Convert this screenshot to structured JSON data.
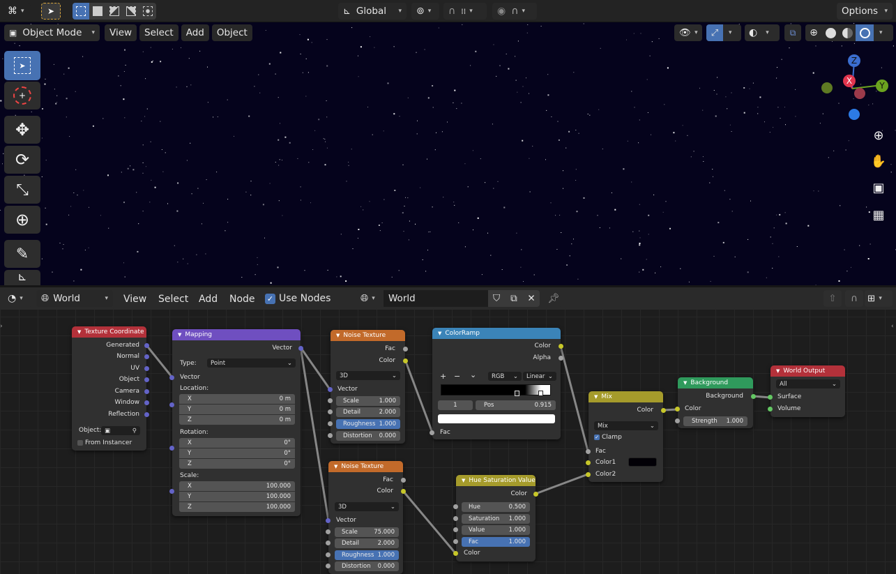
{
  "header": {
    "transform_orientation": "Global",
    "options_label": "Options"
  },
  "viewport": {
    "mode": "Object Mode",
    "menus": [
      "View",
      "Select",
      "Add",
      "Object"
    ],
    "gizmo": {
      "x": "X",
      "y": "Y",
      "z": "Z"
    },
    "bg_color": "#05031c"
  },
  "node_editor": {
    "type": "World",
    "menus": [
      "View",
      "Select",
      "Add",
      "Node"
    ],
    "use_nodes_label": "Use Nodes",
    "world_name": "World"
  },
  "nodes": {
    "texcoord": {
      "title": "Texture Coordinate",
      "outputs": [
        "Generated",
        "Normal",
        "UV",
        "Object",
        "Camera",
        "Window",
        "Reflection"
      ],
      "object_label": "Object:",
      "from_instancer": "From Instancer"
    },
    "mapping": {
      "title": "Mapping",
      "output": "Vector",
      "type_label": "Type:",
      "type_value": "Point",
      "vector": "Vector",
      "location": "Location:",
      "loc": [
        [
          "X",
          "0 m"
        ],
        [
          "Y",
          "0 m"
        ],
        [
          "Z",
          "0 m"
        ]
      ],
      "rotation": "Rotation:",
      "rot": [
        [
          "X",
          "0°"
        ],
        [
          "Y",
          "0°"
        ],
        [
          "Z",
          "0°"
        ]
      ],
      "scale": "Scale:",
      "sca": [
        [
          "X",
          "100.000"
        ],
        [
          "Y",
          "100.000"
        ],
        [
          "Z",
          "100.000"
        ]
      ]
    },
    "noise1": {
      "title": "Noise Texture",
      "fac": "Fac",
      "color": "Color",
      "dim": "3D",
      "vector": "Vector",
      "fields": [
        [
          "Scale",
          "1.000"
        ],
        [
          "Detail",
          "2.000"
        ],
        [
          "Roughness",
          "1.000"
        ],
        [
          "Distortion",
          "0.000"
        ]
      ]
    },
    "noise2": {
      "title": "Noise Texture",
      "fac": "Fac",
      "color": "Color",
      "dim": "3D",
      "vector": "Vector",
      "fields": [
        [
          "Scale",
          "75.000"
        ],
        [
          "Detail",
          "2.000"
        ],
        [
          "Roughness",
          "1.000"
        ],
        [
          "Distortion",
          "0.000"
        ]
      ]
    },
    "colorramp": {
      "title": "ColorRamp",
      "color": "Color",
      "alpha": "Alpha",
      "plus": "+",
      "minus": "−",
      "chev": "⌄",
      "mode": "RGB",
      "interp": "Linear",
      "index": "1",
      "pos_label": "Pos",
      "pos_value": "0.915",
      "fac": "Fac"
    },
    "hsv": {
      "title": "Hue Saturation Value",
      "color_out": "Color",
      "fields": [
        [
          "Hue",
          "0.500"
        ],
        [
          "Saturation",
          "1.000"
        ],
        [
          "Value",
          "1.000"
        ],
        [
          "Fac",
          "1.000"
        ]
      ],
      "color_in": "Color"
    },
    "mix": {
      "title": "Mix",
      "color_out": "Color",
      "blend": "Mix",
      "clamp": "Clamp",
      "fac": "Fac",
      "color1": "Color1",
      "color2": "Color2"
    },
    "background": {
      "title": "Background",
      "out": "Background",
      "color": "Color",
      "strength_label": "Strength",
      "strength_value": "1.000"
    },
    "output": {
      "title": "World Output",
      "target": "All",
      "surface": "Surface",
      "volume": "Volume"
    }
  },
  "colors": {
    "texcoord_header": "#b3313a",
    "mapping_header": "#6f4fc0",
    "noise_header": "#c26a2a",
    "colorramp_header": "#3b84b8",
    "hsv_header": "#a59b2b",
    "mix_header": "#a59b2b",
    "background_header": "#2f9a5c",
    "output_header": "#b3313a"
  }
}
